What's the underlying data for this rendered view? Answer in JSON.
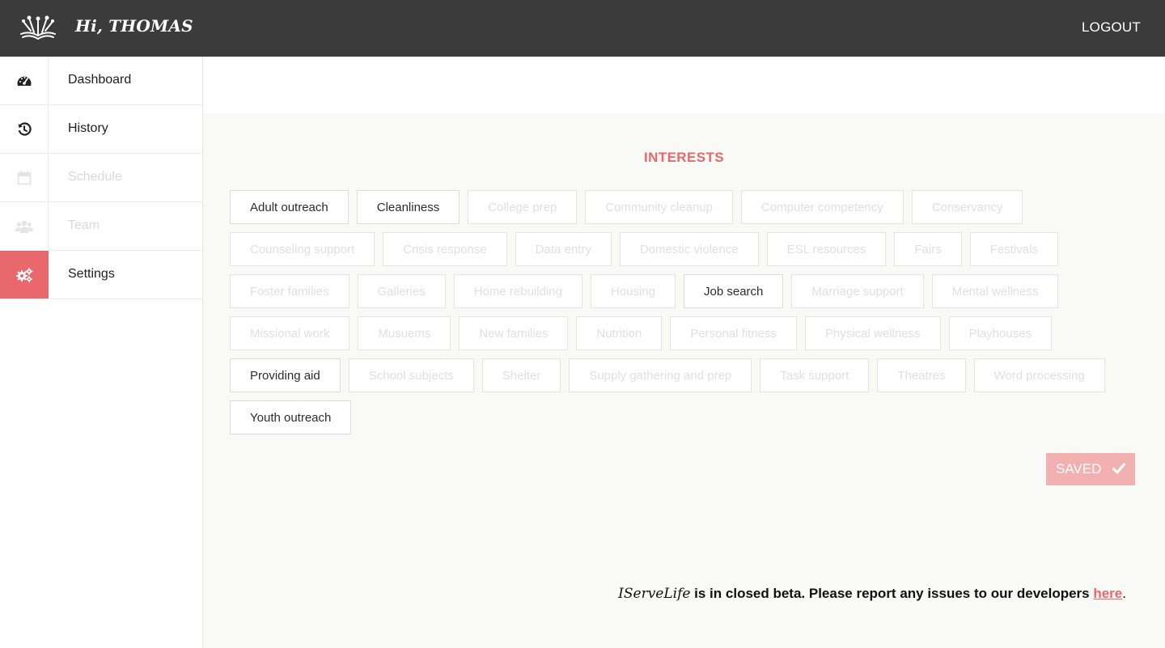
{
  "header": {
    "greeting": "Hi, THOMAS",
    "logout_label": "LOGOUT",
    "logo_icon": "open-book-logo-icon"
  },
  "sidebar": {
    "items": [
      {
        "label": "Dashboard",
        "icon": "dashboard-icon",
        "state": "enabled"
      },
      {
        "label": "History",
        "icon": "history-icon",
        "state": "enabled"
      },
      {
        "label": "Schedule",
        "icon": "calendar-icon",
        "state": "disabled"
      },
      {
        "label": "Team",
        "icon": "team-icon",
        "state": "disabled"
      },
      {
        "label": "Settings",
        "icon": "gears-icon",
        "state": "active"
      }
    ]
  },
  "main": {
    "title": "INTERESTS",
    "interests": [
      {
        "label": "Adult outreach",
        "selected": true
      },
      {
        "label": "Cleanliness",
        "selected": true
      },
      {
        "label": "College prep",
        "selected": false
      },
      {
        "label": "Community cleanup",
        "selected": false
      },
      {
        "label": "Computer competency",
        "selected": false
      },
      {
        "label": "Conservancy",
        "selected": false
      },
      {
        "label": "Counseling support",
        "selected": false
      },
      {
        "label": "Crisis response",
        "selected": false
      },
      {
        "label": "Data entry",
        "selected": false
      },
      {
        "label": "Domestic violence",
        "selected": false
      },
      {
        "label": "ESL resources",
        "selected": false
      },
      {
        "label": "Fairs",
        "selected": false
      },
      {
        "label": "Festivals",
        "selected": false
      },
      {
        "label": "Foster families",
        "selected": false
      },
      {
        "label": "Galleries",
        "selected": false
      },
      {
        "label": "Home rebuilding",
        "selected": false
      },
      {
        "label": "Housing",
        "selected": false
      },
      {
        "label": "Job search",
        "selected": true
      },
      {
        "label": "Marriage support",
        "selected": false
      },
      {
        "label": "Mental wellness",
        "selected": false
      },
      {
        "label": "Missional work",
        "selected": false
      },
      {
        "label": "Musuems",
        "selected": false
      },
      {
        "label": "New families",
        "selected": false
      },
      {
        "label": "Nutrition",
        "selected": false
      },
      {
        "label": "Personal fitness",
        "selected": false
      },
      {
        "label": "Physical wellness",
        "selected": false
      },
      {
        "label": "Playhouses",
        "selected": false
      },
      {
        "label": "Providing aid",
        "selected": true
      },
      {
        "label": "School subjects",
        "selected": false
      },
      {
        "label": "Shelter",
        "selected": false
      },
      {
        "label": "Supply gathering and prep",
        "selected": false
      },
      {
        "label": "Task support",
        "selected": false
      },
      {
        "label": "Theatres",
        "selected": false
      },
      {
        "label": "Word processing",
        "selected": false
      },
      {
        "label": "Youth outreach",
        "selected": true
      }
    ],
    "saved_label": "SAVED",
    "saved_icon": "checkmark-icon"
  },
  "footer": {
    "brand": "IServeLife",
    "message": " is in closed beta. Please report any issues to our developers ",
    "link_text": "here",
    "end": "."
  },
  "colors": {
    "accent": "#e8686b",
    "topbar": "#3b3b3b",
    "saved_button": "#f2b0b1"
  }
}
